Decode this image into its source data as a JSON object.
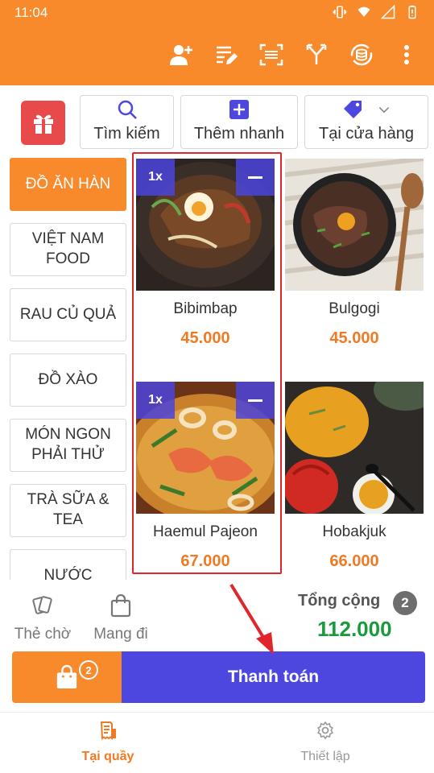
{
  "status_bar": {
    "time": "11:04"
  },
  "toolbar": {
    "icons": [
      "add-user-icon",
      "edit-list-icon",
      "barcode-scan-icon",
      "merge-icon",
      "sync-icon",
      "more-vertical-icon"
    ]
  },
  "actions": {
    "search_label": "Tìm kiếm",
    "quick_add_label": "Thêm nhanh",
    "store_label": "Tại cửa hàng"
  },
  "categories": [
    {
      "label": "ĐỒ ĂN HÀN",
      "active": true
    },
    {
      "label": "VIỆT NAM FOOD",
      "active": false
    },
    {
      "label": "RAU CỦ QUẢ",
      "active": false
    },
    {
      "label": "ĐỒ XÀO",
      "active": false
    },
    {
      "label": "MÓN NGON PHẢI THỬ",
      "active": false
    },
    {
      "label": "TRÀ SỮA & TEA",
      "active": false
    },
    {
      "label": "NƯỚC",
      "active": false
    }
  ],
  "products": [
    {
      "name": "Bibimbap",
      "price": "45.000",
      "qty": "1x"
    },
    {
      "name": "Bulgogi",
      "price": "45.000",
      "qty": ""
    },
    {
      "name": "Haemul Pajeon",
      "price": "67.000",
      "qty": "1x"
    },
    {
      "name": "Hobakjuk",
      "price": "66.000",
      "qty": ""
    }
  ],
  "options": {
    "hold_label": "Thẻ chờ",
    "takeaway_label": "Mang đi"
  },
  "summary": {
    "total_label": "Tổng cộng",
    "item_count": "2",
    "total_value": "112.000"
  },
  "checkout": {
    "cart_count": "2",
    "pay_label": "Thanh toán"
  },
  "bottom_nav": {
    "counter_label": "Tại quầy",
    "settings_label": "Thiết lập"
  },
  "colors": {
    "brand_orange": "#f88a2b",
    "pay_blue": "#4d47e0",
    "total_green": "#1a9a3c",
    "price_orange": "#f07a24",
    "highlight_red": "#e0262a"
  }
}
